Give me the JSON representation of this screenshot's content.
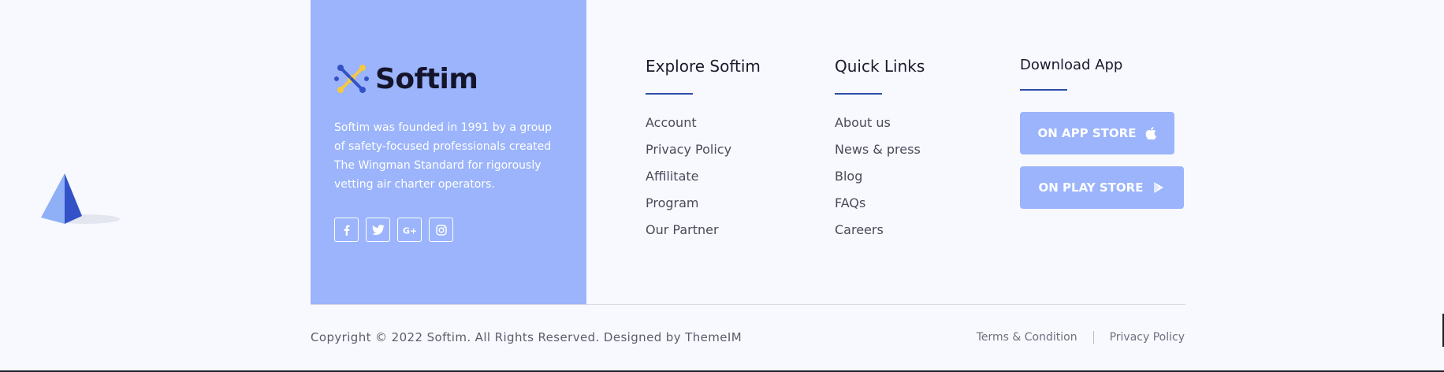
{
  "brand": {
    "name": "Softim",
    "description": "Softim was founded in 1991 by a group of safety-focused professionals created The Wingman Standard for rigorously vetting air charter operators.",
    "panel_color": "#9bb4fb"
  },
  "socials": [
    {
      "icon": "facebook-icon"
    },
    {
      "icon": "twitter-icon"
    },
    {
      "icon": "google-plus-icon"
    },
    {
      "icon": "instagram-icon"
    }
  ],
  "explore": {
    "title": "Explore Softim",
    "links": [
      "Account",
      "Privacy Policy",
      "Affilitate",
      "Program",
      "Our Partner"
    ]
  },
  "quick_links": {
    "title": "Quick Links",
    "links": [
      "About us",
      "News & press",
      "Blog",
      "FAQs",
      "Careers"
    ]
  },
  "download": {
    "title": "Download App",
    "app_store_label": "ON APP STORE",
    "play_store_label": "ON PLAY STORE"
  },
  "footer": {
    "copyright": "Copyright © 2022 Softim. All Rights Reserved. Designed by ThemeIM",
    "terms_label": "Terms & Condition",
    "privacy_label": "Privacy Policy"
  },
  "colors": {
    "accent": "#9bb4fb",
    "rule": "#2d4ea8",
    "background": "#f8f9fe"
  }
}
